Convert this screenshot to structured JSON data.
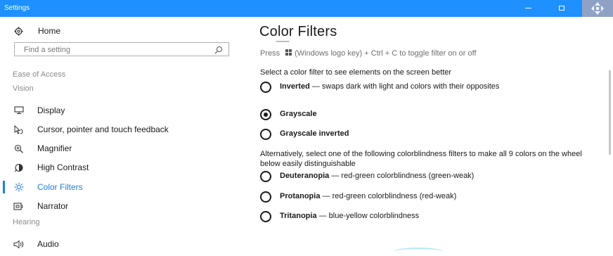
{
  "window": {
    "title": "Settings",
    "accent": "#1e90ff"
  },
  "sidebar": {
    "home_label": "Home",
    "search_placeholder": "Find a setting",
    "category": "Ease of Access",
    "group_vision": "Vision",
    "items": [
      {
        "label": "Display",
        "icon": "display-icon"
      },
      {
        "label": "Cursor, pointer and touch feedback",
        "icon": "cursor-icon"
      },
      {
        "label": "Magnifier",
        "icon": "magnifier-icon"
      },
      {
        "label": "High Contrast",
        "icon": "high-contrast-icon"
      },
      {
        "label": "Color Filters",
        "icon": "color-filters-icon",
        "active": true
      },
      {
        "label": "Narrator",
        "icon": "narrator-icon"
      }
    ],
    "group_hearing": "Hearing",
    "hearing_items": [
      {
        "label": "Audio",
        "icon": "audio-icon"
      }
    ]
  },
  "main": {
    "title": "Color Filters",
    "hint_press": "Press",
    "hint_rest": "(Windows logo key) + Ctrl + C to toggle filter on or off",
    "select_text": "Select a color filter to see elements on the screen better",
    "filters": [
      {
        "name": "Inverted",
        "desc": "— swaps dark with light and colors with their opposites",
        "checked": false
      },
      {
        "name": "Grayscale",
        "desc": "",
        "checked": true
      },
      {
        "name": "Grayscale inverted",
        "desc": "",
        "checked": false
      }
    ],
    "alt_text": "Alternatively, select one of the following colorblindness filters to make all 9 colors on the wheel below easily distinguishable",
    "colorblind_filters": [
      {
        "name": "Deuteranopia",
        "desc": "— red-green colorblindness (green-weak)",
        "checked": false
      },
      {
        "name": "Protanopia",
        "desc": "— red-green colorblindness (red-weak)",
        "checked": false
      },
      {
        "name": "Tritanopia",
        "desc": "— blue-yellow colorblindness",
        "checked": false
      }
    ]
  }
}
